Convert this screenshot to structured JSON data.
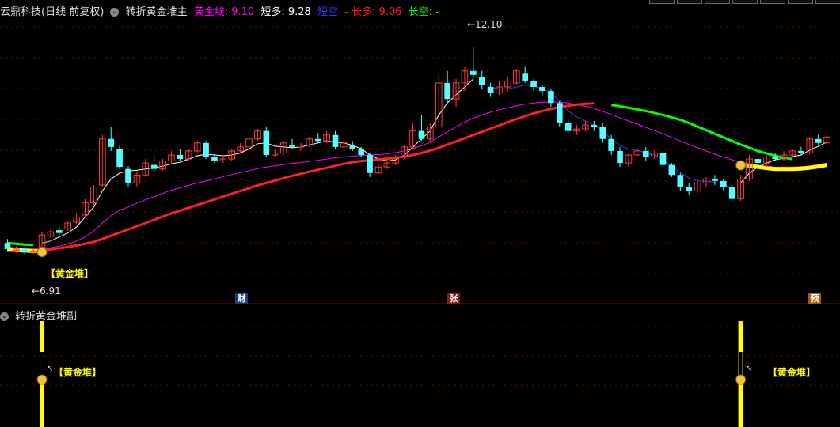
{
  "header": {
    "title": "云鼎科技(日线 前复权)",
    "indicator": "转折黄金堆主",
    "items": [
      {
        "label": "黄金线:",
        "value": "9.10",
        "color": "#ff00ff"
      },
      {
        "label": "短多:",
        "value": "9.28",
        "color": "#ffffff"
      },
      {
        "label": "短空",
        "value": "",
        "color": "#3a3aff"
      },
      {
        "label": "- 长多:",
        "value": "9.06",
        "color": "#ff2020"
      },
      {
        "label": "长空:",
        "value": "-",
        "color": "#00ff00"
      }
    ]
  },
  "sub_header": {
    "title": "转折黄金堆副"
  },
  "annotations": {
    "high": "12.10",
    "low": "6.91",
    "gold_label": "【黄金堆】",
    "markers": [
      "财",
      "张",
      "预"
    ]
  },
  "chart_data": {
    "type": "candlestick",
    "ylim": [
      6.0,
      12.8
    ],
    "candles": [
      [
        7.2,
        7.05,
        7.3,
        6.98
      ],
      [
        7.02,
        7.05,
        7.12,
        6.95
      ],
      [
        7.06,
        6.96,
        7.1,
        6.91
      ],
      [
        6.98,
        7.0,
        7.05,
        6.92
      ],
      [
        7.1,
        7.4,
        7.48,
        7.05
      ],
      [
        7.38,
        7.48,
        7.55,
        7.33
      ],
      [
        7.52,
        7.45,
        7.6,
        7.4
      ],
      [
        7.55,
        7.7,
        7.75,
        7.5
      ],
      [
        7.72,
        7.85,
        7.95,
        7.68
      ],
      [
        7.9,
        8.2,
        8.3,
        7.85
      ],
      [
        8.2,
        8.6,
        8.65,
        8.15
      ],
      [
        8.65,
        9.8,
        9.9,
        8.6
      ],
      [
        9.8,
        9.6,
        10.1,
        9.5
      ],
      [
        9.55,
        9.1,
        9.65,
        9.05
      ],
      [
        9.05,
        8.7,
        9.12,
        8.6
      ],
      [
        8.7,
        8.9,
        9.0,
        8.6
      ],
      [
        8.9,
        9.2,
        9.3,
        8.85
      ],
      [
        9.15,
        9.05,
        9.4,
        8.98
      ],
      [
        9.05,
        9.25,
        9.3,
        9.0
      ],
      [
        9.25,
        9.4,
        9.5,
        9.2
      ],
      [
        9.4,
        9.3,
        9.55,
        9.25
      ],
      [
        9.3,
        9.5,
        9.55,
        9.25
      ],
      [
        9.5,
        9.7,
        9.75,
        9.45
      ],
      [
        9.7,
        9.35,
        9.75,
        9.3
      ],
      [
        9.35,
        9.25,
        9.4,
        9.2
      ],
      [
        9.25,
        9.3,
        9.4,
        9.2
      ],
      [
        9.3,
        9.5,
        9.55,
        9.25
      ],
      [
        9.5,
        9.6,
        9.7,
        9.45
      ],
      [
        9.6,
        9.8,
        9.85,
        9.55
      ],
      [
        9.8,
        10.0,
        10.05,
        9.75
      ],
      [
        10.0,
        9.4,
        10.1,
        9.35
      ],
      [
        9.4,
        9.45,
        9.55,
        9.35
      ],
      [
        9.45,
        9.7,
        9.75,
        9.4
      ],
      [
        9.65,
        9.6,
        9.8,
        9.55
      ],
      [
        9.6,
        9.65,
        9.7,
        9.5
      ],
      [
        9.65,
        9.8,
        9.85,
        9.6
      ],
      [
        9.8,
        9.75,
        9.95,
        9.7
      ],
      [
        9.75,
        9.9,
        10.0,
        9.7
      ],
      [
        9.9,
        9.6,
        10.0,
        9.55
      ],
      [
        9.6,
        9.7,
        9.8,
        9.5
      ],
      [
        9.65,
        9.55,
        9.75,
        9.5
      ],
      [
        9.55,
        9.4,
        9.6,
        9.35
      ],
      [
        9.4,
        8.95,
        9.45,
        8.85
      ],
      [
        8.95,
        9.1,
        9.2,
        8.9
      ],
      [
        9.1,
        9.2,
        9.3,
        9.05
      ],
      [
        9.2,
        9.35,
        9.4,
        9.15
      ],
      [
        9.35,
        9.6,
        9.65,
        9.3
      ],
      [
        9.6,
        10.0,
        10.2,
        9.55
      ],
      [
        10.0,
        9.8,
        10.4,
        9.75
      ],
      [
        9.8,
        10.1,
        10.2,
        9.7
      ],
      [
        10.1,
        11.2,
        11.4,
        10.05
      ],
      [
        11.2,
        10.8,
        11.5,
        10.7
      ],
      [
        10.8,
        11.2,
        11.3,
        10.6
      ],
      [
        11.2,
        11.5,
        11.6,
        11.0
      ],
      [
        11.5,
        11.4,
        12.1,
        11.3
      ],
      [
        11.35,
        11.15,
        11.5,
        11.05
      ],
      [
        11.1,
        10.95,
        11.2,
        10.85
      ],
      [
        10.95,
        11.1,
        11.25,
        10.9
      ],
      [
        11.1,
        11.25,
        11.35,
        11.0
      ],
      [
        11.2,
        11.5,
        11.55,
        11.15
      ],
      [
        11.45,
        11.25,
        11.6,
        11.2
      ],
      [
        11.25,
        11.1,
        11.3,
        11.0
      ],
      [
        11.1,
        11.0,
        11.15,
        10.9
      ],
      [
        11.0,
        10.7,
        11.05,
        10.6
      ],
      [
        10.7,
        10.2,
        10.75,
        10.1
      ],
      [
        10.2,
        10.0,
        10.3,
        9.95
      ],
      [
        10.0,
        10.05,
        10.15,
        9.9
      ],
      [
        10.05,
        10.15,
        10.25,
        10.0
      ],
      [
        10.15,
        10.1,
        10.25,
        10.0
      ],
      [
        10.1,
        9.8,
        10.2,
        9.7
      ],
      [
        9.8,
        9.5,
        9.9,
        9.4
      ],
      [
        9.5,
        9.2,
        9.6,
        9.1
      ],
      [
        9.2,
        9.4,
        9.45,
        9.1
      ],
      [
        9.4,
        9.5,
        9.55,
        9.35
      ],
      [
        9.5,
        9.35,
        9.6,
        9.25
      ],
      [
        9.35,
        9.45,
        9.5,
        9.3
      ],
      [
        9.45,
        9.15,
        9.5,
        9.1
      ],
      [
        9.15,
        8.9,
        9.2,
        8.85
      ],
      [
        8.9,
        8.6,
        8.95,
        8.5
      ],
      [
        8.6,
        8.5,
        8.7,
        8.4
      ],
      [
        8.5,
        8.7,
        8.75,
        8.45
      ],
      [
        8.7,
        8.8,
        8.85,
        8.6
      ],
      [
        8.8,
        8.75,
        8.9,
        8.65
      ],
      [
        8.75,
        8.6,
        8.8,
        8.5
      ],
      [
        8.6,
        8.3,
        8.65,
        8.2
      ],
      [
        8.3,
        8.8,
        8.9,
        8.25
      ],
      [
        8.8,
        9.3,
        9.4,
        8.75
      ],
      [
        9.3,
        9.2,
        9.45,
        9.15
      ],
      [
        9.2,
        9.35,
        9.4,
        9.1
      ],
      [
        9.35,
        9.3,
        9.45,
        9.25
      ],
      [
        9.3,
        9.4,
        9.5,
        9.25
      ],
      [
        9.4,
        9.5,
        9.55,
        9.35
      ],
      [
        9.5,
        9.45,
        9.6,
        9.4
      ],
      [
        9.45,
        9.8,
        9.85,
        9.4
      ],
      [
        9.8,
        9.7,
        9.9,
        9.65
      ],
      [
        9.7,
        9.85,
        10.05,
        9.65
      ]
    ],
    "series": [
      {
        "name": "黄金线",
        "color": "#ff00ff",
        "values": [
          7.1,
          7.08,
          7.06,
          7.05,
          7.05,
          7.08,
          7.12,
          7.18,
          7.25,
          7.35,
          7.5,
          7.7,
          7.88,
          8.02,
          8.1,
          8.2,
          8.28,
          8.36,
          8.44,
          8.52,
          8.58,
          8.64,
          8.7,
          8.75,
          8.8,
          8.86,
          8.91,
          8.96,
          9.01,
          9.06,
          9.1,
          9.13,
          9.16,
          9.19,
          9.21,
          9.24,
          9.27,
          9.3,
          9.33,
          9.35,
          9.37,
          9.39,
          9.4,
          9.41,
          9.43,
          9.46,
          9.5,
          9.56,
          9.63,
          9.72,
          9.85,
          9.98,
          10.1,
          10.22,
          10.32,
          10.4,
          10.47,
          10.53,
          10.58,
          10.63,
          10.67,
          10.7,
          10.72,
          10.73,
          10.72,
          10.7,
          10.66,
          10.62,
          10.56,
          10.49,
          10.41,
          10.33,
          10.25,
          10.17,
          10.09,
          10.01,
          9.93,
          9.84,
          9.75,
          9.66,
          9.58,
          9.5,
          9.42,
          9.35,
          9.28,
          9.22,
          9.18,
          9.15,
          9.12,
          9.1,
          9.1,
          9.1,
          9.11,
          9.13,
          9.16,
          9.2
        ]
      },
      {
        "name": "短多",
        "color": "#ffffff",
        "values": [
          null,
          null,
          null,
          null,
          7.2,
          7.25,
          7.35,
          7.45,
          7.6,
          7.85,
          8.1,
          8.5,
          8.8,
          8.95,
          9.0,
          9.02,
          9.05,
          9.08,
          9.12,
          9.18,
          9.22,
          9.3,
          9.38,
          9.42,
          9.4,
          9.38,
          9.4,
          9.45,
          9.55,
          9.68,
          9.7,
          9.62,
          9.6,
          9.58,
          9.6,
          9.65,
          9.7,
          9.75,
          9.72,
          9.7,
          9.64,
          9.56,
          9.4,
          9.3,
          9.25,
          9.28,
          9.4,
          9.6,
          9.8,
          10.0,
          10.4,
          10.7,
          10.9,
          11.1,
          11.3,
          null,
          null,
          null,
          null,
          null,
          null,
          null,
          null,
          null,
          null,
          null,
          null,
          null,
          null,
          null,
          null,
          null,
          null,
          null,
          null,
          null,
          null,
          null,
          null,
          null,
          null,
          null,
          null,
          null,
          null,
          8.7,
          8.95,
          9.1,
          9.2,
          9.28,
          9.32,
          9.36,
          9.4,
          9.52,
          9.62,
          9.72
        ]
      },
      {
        "name": "短空",
        "color": "#3a3aff",
        "values": [
          null,
          null,
          null,
          null,
          null,
          null,
          null,
          null,
          null,
          null,
          null,
          null,
          null,
          null,
          null,
          null,
          null,
          null,
          null,
          null,
          null,
          null,
          null,
          null,
          null,
          null,
          null,
          null,
          null,
          null,
          null,
          null,
          null,
          null,
          null,
          null,
          null,
          null,
          null,
          null,
          null,
          null,
          null,
          null,
          null,
          null,
          null,
          null,
          null,
          null,
          null,
          null,
          null,
          null,
          null,
          11.2,
          11.1,
          11.05,
          11.05,
          11.1,
          11.15,
          11.12,
          11.05,
          10.95,
          10.75,
          10.5,
          10.35,
          10.25,
          10.15,
          10.0,
          9.8,
          9.65,
          9.55,
          9.52,
          9.45,
          9.4,
          9.28,
          9.12,
          8.96,
          8.82,
          8.76,
          8.74,
          8.72,
          8.66,
          8.58,
          null,
          null,
          null,
          null,
          null,
          null,
          null,
          null,
          null,
          null,
          null
        ]
      },
      {
        "name": "长多",
        "color": "#ff2020",
        "values": [
          7.0,
          7.0,
          7.0,
          7.0,
          7.02,
          7.04,
          7.07,
          7.1,
          7.14,
          7.18,
          7.23,
          7.3,
          7.38,
          7.46,
          7.54,
          7.62,
          7.7,
          7.78,
          7.86,
          7.94,
          8.01,
          8.08,
          8.15,
          8.22,
          8.29,
          8.36,
          8.43,
          8.5,
          8.57,
          8.64,
          8.7,
          8.76,
          8.82,
          8.88,
          8.93,
          8.98,
          9.03,
          9.08,
          9.13,
          9.18,
          9.22,
          9.25,
          9.27,
          9.29,
          9.31,
          9.33,
          9.36,
          9.4,
          9.45,
          9.51,
          9.58,
          9.66,
          9.74,
          9.82,
          9.9,
          9.98,
          10.06,
          10.14,
          10.22,
          10.3,
          10.37,
          10.44,
          10.5,
          10.55,
          10.6,
          10.63,
          10.66,
          10.68,
          10.69,
          null,
          null,
          null,
          null,
          null,
          null,
          null,
          null,
          null,
          null,
          null,
          null,
          null,
          null,
          null,
          null,
          null,
          null,
          null,
          null,
          null,
          null,
          null,
          null,
          null,
          null,
          9.06
        ]
      },
      {
        "name": "长空",
        "color": "#00ff00",
        "values": [
          7.2,
          7.18,
          7.16,
          7.15,
          null,
          null,
          null,
          null,
          null,
          null,
          null,
          null,
          null,
          null,
          null,
          null,
          null,
          null,
          null,
          null,
          null,
          null,
          null,
          null,
          null,
          null,
          null,
          null,
          null,
          null,
          null,
          null,
          null,
          null,
          null,
          null,
          null,
          null,
          null,
          null,
          null,
          null,
          null,
          null,
          null,
          null,
          null,
          null,
          null,
          null,
          null,
          null,
          null,
          null,
          null,
          null,
          null,
          null,
          null,
          null,
          null,
          null,
          null,
          null,
          null,
          null,
          null,
          null,
          null,
          null,
          10.65,
          10.62,
          10.58,
          10.54,
          10.5,
          10.45,
          10.4,
          10.34,
          10.28,
          10.2,
          10.11,
          10.02,
          9.93,
          9.84,
          9.75,
          9.66,
          9.58,
          9.5,
          9.44,
          9.38,
          9.33,
          9.3,
          null,
          null,
          null,
          null
        ]
      }
    ],
    "gold_pile_segments": [
      [
        0,
        4
      ],
      [
        85,
        95
      ]
    ],
    "sub_signals": [
      4,
      85
    ]
  }
}
